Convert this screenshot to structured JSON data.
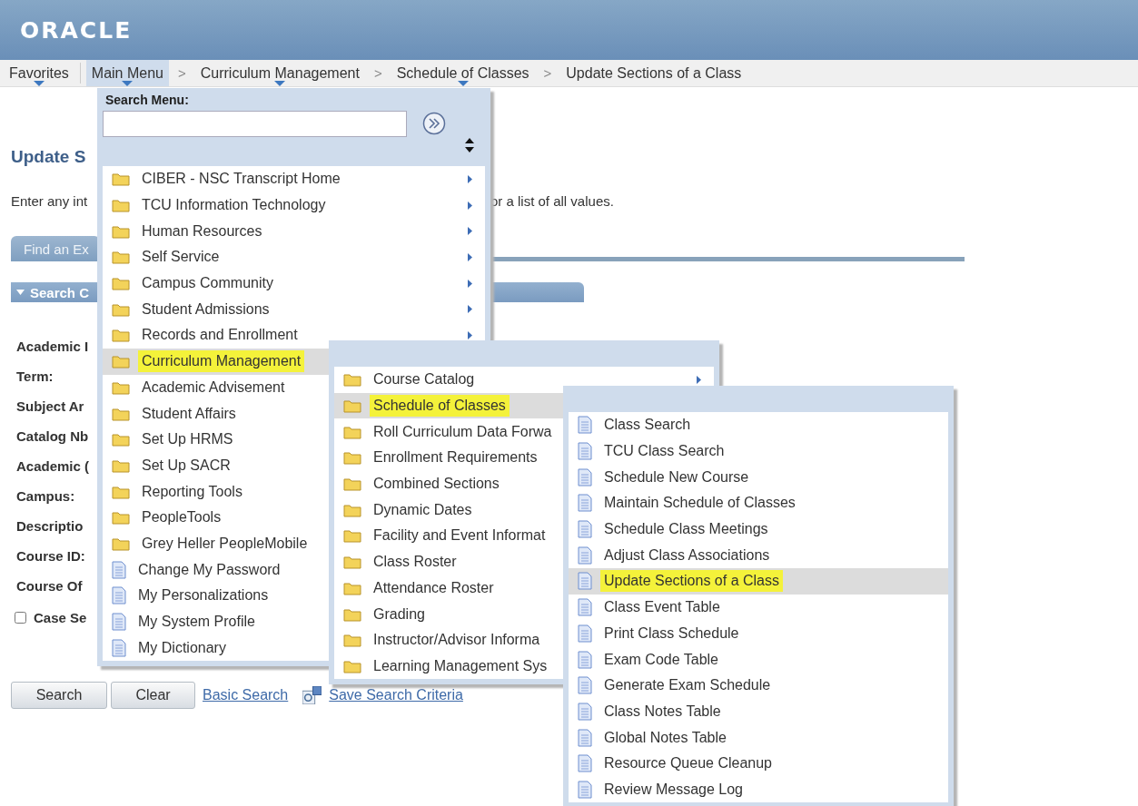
{
  "header": {
    "logo": "ORACLE"
  },
  "breadcrumb": [
    {
      "text": "Favorites",
      "dropdown": true,
      "open": false
    },
    {
      "text": "Main Menu",
      "dropdown": true,
      "open": true
    },
    {
      "text": "Curriculum Management",
      "separator": ">",
      "dropdown": true,
      "open": false
    },
    {
      "text": "Schedule of Classes",
      "separator": ">",
      "dropdown": true,
      "open": false
    },
    {
      "text": "Update Sections of a Class",
      "separator": ">",
      "dropdown": false,
      "open": false
    }
  ],
  "page": {
    "title": "Update S",
    "instructions": [
      "Enter any int",
      "or a list of all values."
    ],
    "tab": "Find an Ex",
    "section": "Search C",
    "fields": [
      "Academic I",
      "Term:",
      "Subject Ar",
      "Catalog Nb",
      "Academic (",
      "Campus:",
      "Descriptio",
      "Course ID:",
      "Course Of"
    ],
    "checkbox": {
      "label": "Case Se",
      "checked": false
    },
    "buttons": [
      "Search",
      "Clear"
    ],
    "links": [
      "Basic Search",
      "Save Search Criteria"
    ]
  },
  "menus": [
    {
      "search": {
        "label": "Search Menu:"
      },
      "items": [
        {
          "label": "CIBER - NSC Transcript Home",
          "kind": "folder",
          "submenu": true,
          "selected": false
        },
        {
          "label": "TCU Information Technology",
          "kind": "folder",
          "submenu": true,
          "selected": false
        },
        {
          "label": "Human Resources",
          "kind": "folder",
          "submenu": true,
          "selected": false
        },
        {
          "label": "Self Service",
          "kind": "folder",
          "submenu": true,
          "selected": false
        },
        {
          "label": "Campus Community",
          "kind": "folder",
          "submenu": true,
          "selected": false
        },
        {
          "label": "Student Admissions",
          "kind": "folder",
          "submenu": true,
          "selected": false
        },
        {
          "label": "Records and Enrollment",
          "kind": "folder",
          "submenu": true,
          "selected": false
        },
        {
          "label": "Curriculum Management",
          "kind": "folder",
          "submenu": false,
          "selected": true
        },
        {
          "label": "Academic Advisement",
          "kind": "folder",
          "submenu": false,
          "selected": false
        },
        {
          "label": "Student Affairs",
          "kind": "folder",
          "submenu": false,
          "selected": false
        },
        {
          "label": "Set Up HRMS",
          "kind": "folder",
          "submenu": false,
          "selected": false
        },
        {
          "label": "Set Up SACR",
          "kind": "folder",
          "submenu": false,
          "selected": false
        },
        {
          "label": "Reporting Tools",
          "kind": "folder",
          "submenu": false,
          "selected": false
        },
        {
          "label": "PeopleTools",
          "kind": "folder",
          "submenu": false,
          "selected": false
        },
        {
          "label": "Grey Heller PeopleMobile",
          "kind": "folder",
          "submenu": false,
          "selected": false
        },
        {
          "label": "Change My Password",
          "kind": "page",
          "submenu": false,
          "selected": false
        },
        {
          "label": "My Personalizations",
          "kind": "page",
          "submenu": false,
          "selected": false
        },
        {
          "label": "My System Profile",
          "kind": "page",
          "submenu": false,
          "selected": false
        },
        {
          "label": "My Dictionary",
          "kind": "page",
          "submenu": false,
          "selected": false
        }
      ]
    },
    {
      "items": [
        {
          "label": "Course Catalog",
          "kind": "folder",
          "submenu": true,
          "selected": false
        },
        {
          "label": "Schedule of Classes",
          "kind": "folder",
          "submenu": false,
          "selected": true
        },
        {
          "label": "Roll Curriculum Data Forwa",
          "kind": "folder",
          "submenu": false,
          "selected": false
        },
        {
          "label": "Enrollment Requirements",
          "kind": "folder",
          "submenu": false,
          "selected": false
        },
        {
          "label": "Combined Sections",
          "kind": "folder",
          "submenu": false,
          "selected": false
        },
        {
          "label": "Dynamic Dates",
          "kind": "folder",
          "submenu": false,
          "selected": false
        },
        {
          "label": "Facility and Event Informat",
          "kind": "folder",
          "submenu": false,
          "selected": false
        },
        {
          "label": "Class Roster",
          "kind": "folder",
          "submenu": false,
          "selected": false
        },
        {
          "label": "Attendance Roster",
          "kind": "folder",
          "submenu": false,
          "selected": false
        },
        {
          "label": "Grading",
          "kind": "folder",
          "submenu": false,
          "selected": false
        },
        {
          "label": "Instructor/Advisor Informa",
          "kind": "folder",
          "submenu": false,
          "selected": false
        },
        {
          "label": "Learning Management Sys",
          "kind": "folder",
          "submenu": false,
          "selected": false
        }
      ]
    },
    {
      "items": [
        {
          "label": "Class Search",
          "kind": "page",
          "submenu": false,
          "selected": false
        },
        {
          "label": "TCU Class Search",
          "kind": "page",
          "submenu": false,
          "selected": false
        },
        {
          "label": "Schedule New Course",
          "kind": "page",
          "submenu": false,
          "selected": false
        },
        {
          "label": "Maintain Schedule of Classes",
          "kind": "page",
          "submenu": false,
          "selected": false
        },
        {
          "label": "Schedule Class Meetings",
          "kind": "page",
          "submenu": false,
          "selected": false
        },
        {
          "label": "Adjust Class Associations",
          "kind": "page",
          "submenu": false,
          "selected": false
        },
        {
          "label": "Update Sections of a Class",
          "kind": "page",
          "submenu": false,
          "selected": true
        },
        {
          "label": "Class Event Table",
          "kind": "page",
          "submenu": false,
          "selected": false
        },
        {
          "label": "Print Class Schedule",
          "kind": "page",
          "submenu": false,
          "selected": false
        },
        {
          "label": "Exam Code Table",
          "kind": "page",
          "submenu": false,
          "selected": false
        },
        {
          "label": "Generate Exam Schedule",
          "kind": "page",
          "submenu": false,
          "selected": false
        },
        {
          "label": "Class Notes Table",
          "kind": "page",
          "submenu": false,
          "selected": false
        },
        {
          "label": "Global Notes Table",
          "kind": "page",
          "submenu": false,
          "selected": false
        },
        {
          "label": "Resource Queue Cleanup",
          "kind": "page",
          "submenu": false,
          "selected": false
        },
        {
          "label": "Review Message Log",
          "kind": "page",
          "submenu": false,
          "selected": false
        }
      ]
    }
  ]
}
